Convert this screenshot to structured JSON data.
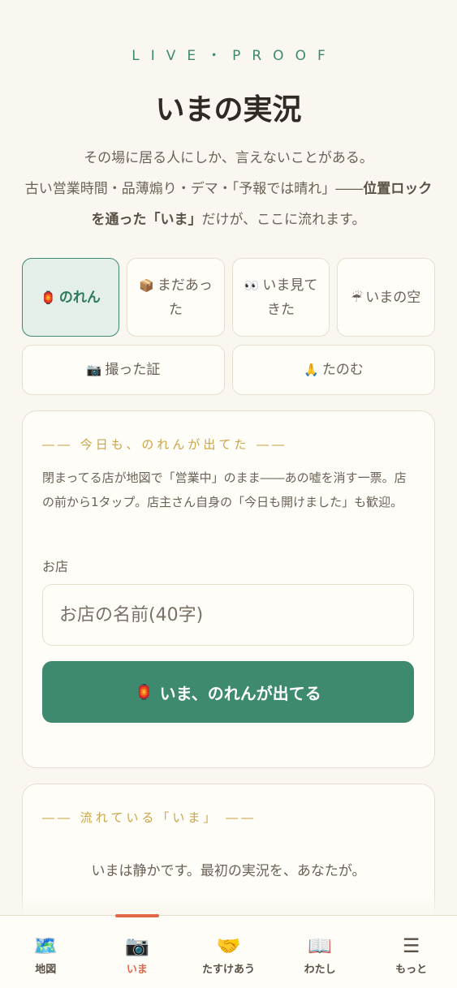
{
  "header": {
    "kicker": "LIVE・PROOF",
    "title": "いまの実況",
    "lead_line1": "その場に居る人にしか、言えないことがある。",
    "lead_line2_pre": "古い営業時間・品薄煽り・デマ・「予報では晴れ」――",
    "lead_line2_bold": "位置ロックを通った「いま」",
    "lead_line2_post": "だけが、ここに流れます。"
  },
  "tabs": [
    {
      "emoji": "🏮",
      "label": "のれん",
      "active": true
    },
    {
      "emoji": "📦",
      "label": "まだあった",
      "active": false
    },
    {
      "emoji": "👀",
      "label": "いま見てきた",
      "active": false
    },
    {
      "emoji": "☔",
      "label": "いまの空",
      "active": false
    },
    {
      "emoji": "📷",
      "label": "撮った証",
      "active": false
    },
    {
      "emoji": "🙏",
      "label": "たのむ",
      "active": false
    }
  ],
  "form_card": {
    "heading": "―― 今日も、のれんが出てた ――",
    "description": "閉まってる店が地図で「営業中」のまま――あの嘘を消す一票。店の前から1タップ。店主さん自身の「今日も開けました」も歓迎。",
    "field_label": "お店",
    "input_placeholder": "お店の名前(40字)",
    "input_value": "",
    "submit_emoji": "🏮",
    "submit_label": "いま、のれんが出てる"
  },
  "feed_card": {
    "heading": "―― 流れている「いま」 ――",
    "empty_message": "いまは静かです。最初の実況を、あなたが。"
  },
  "navbar": [
    {
      "icon": "🗺️",
      "label": "地図",
      "active": false
    },
    {
      "icon": "📷",
      "label": "いま",
      "active": true
    },
    {
      "icon": "🤝",
      "label": "たすけあう",
      "active": false
    },
    {
      "icon": "📖",
      "label": "わたし",
      "active": false
    },
    {
      "icon": "☰",
      "label": "もっと",
      "active": false
    }
  ],
  "colors": {
    "accent": "#3d8a6e",
    "gold": "#c9a54a",
    "active_nav": "#e2674a",
    "background": "#faf7f0"
  }
}
